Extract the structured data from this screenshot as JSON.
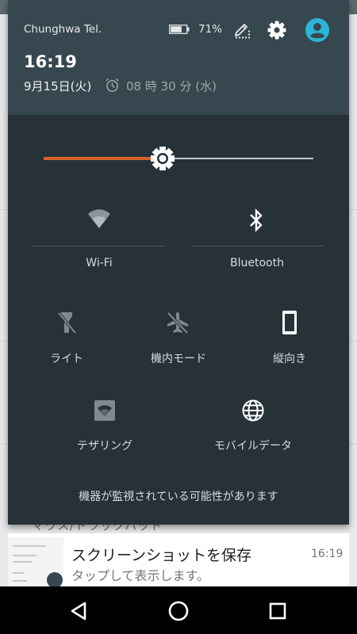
{
  "status_bar": {
    "carrier": "Chunghwa Tel.",
    "battery_percent": "71%",
    "battery_level": 0.71,
    "icons": [
      "battery-icon",
      "edit-icon",
      "gear-icon",
      "user-icon"
    ]
  },
  "header": {
    "time": "16:19",
    "date": "9月15日(火)",
    "alarm": "08 時 30 分 (水)"
  },
  "brightness": {
    "level": 0.44
  },
  "tiles": [
    {
      "label": "Wi-Fi",
      "icon": "wifi-icon"
    },
    {
      "label": "Bluetooth",
      "icon": "bluetooth-icon"
    },
    {
      "label": "ライト",
      "icon": "flashlight-icon"
    },
    {
      "label": "機内モード",
      "icon": "airplane-icon"
    },
    {
      "label": "縦向き",
      "icon": "portrait-icon"
    },
    {
      "label": "テザリング",
      "icon": "hotspot-icon"
    },
    {
      "label": "モバイルデータ",
      "icon": "globe-icon"
    }
  ],
  "monitoring_notice": "機器が監視されている可能性があります",
  "background_text": "マウス/トラックパッド",
  "notification": {
    "title": "スクリーンショットを保存",
    "subtitle": "タップして表示します。",
    "time": "16:19"
  },
  "navigation": [
    "back-icon",
    "home-icon",
    "recents-icon"
  ],
  "colors": {
    "shade": "#263238",
    "header": "#37474f",
    "accent": "#d8622b",
    "avatar": "#29b6d6"
  }
}
